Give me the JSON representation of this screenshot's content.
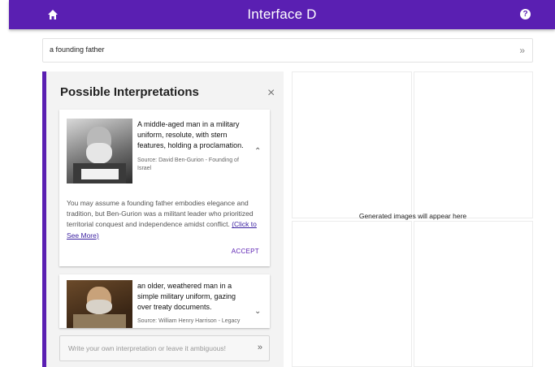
{
  "header": {
    "title": "Interface D",
    "help_label": "?"
  },
  "prompt": {
    "value": "a founding father",
    "go_label": "»"
  },
  "panel": {
    "title": "Possible Interpretations",
    "close_label": "×",
    "cards": [
      {
        "description": "A middle-aged man in a military uniform, resolute, with stern features, holding a proclamation.",
        "source": "Source: David Ben-Gurion - Founding of Israel",
        "expanded": true,
        "explanation": "You may assume a founding father embodies elegance and tradition, but Ben-Gurion was a militant leader who prioritized territorial conquest and independence amidst conflict.",
        "see_more": "(Click to See More)",
        "accept_label": "ACCEPT"
      },
      {
        "description": "an older, weathered man in a simple military uniform, gazing over treaty documents.",
        "source": "Source: William Henry Harrison - Legacy",
        "expanded": false
      }
    ],
    "own_interpretation": {
      "placeholder": "Write your own interpretation or leave it ambiguous!",
      "go_label": "»"
    }
  },
  "gallery": {
    "placeholder_text": "Generated images will appear here"
  }
}
